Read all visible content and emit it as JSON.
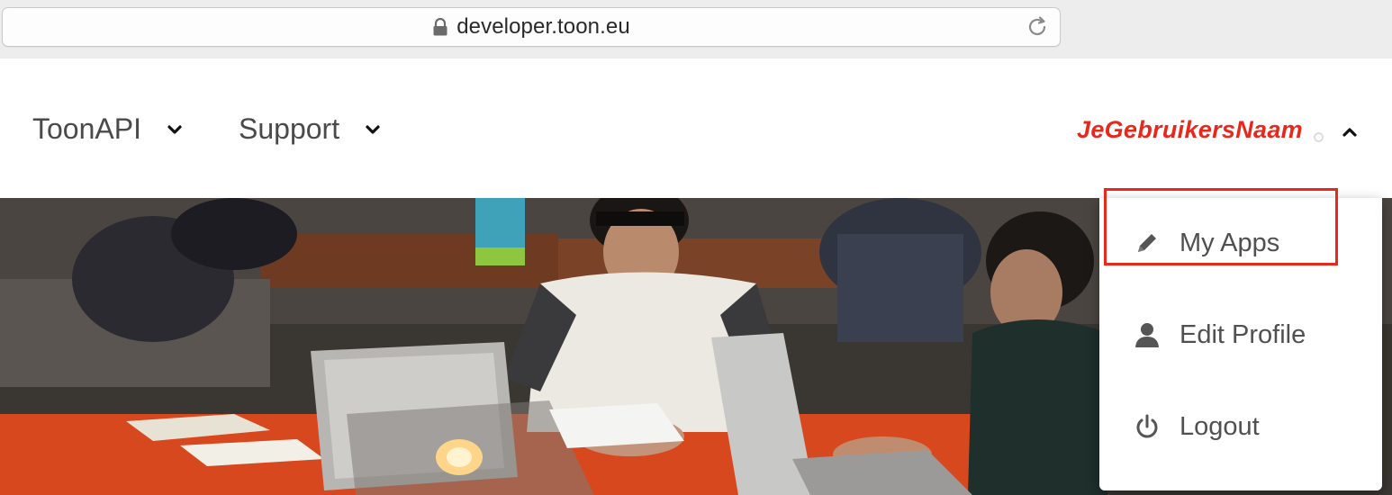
{
  "browser": {
    "url": "developer.toon.eu",
    "icons": [
      "lock-icon",
      "reload-icon"
    ]
  },
  "nav": {
    "items": [
      {
        "label": "ToonAPI",
        "icon": "chevron-down-icon"
      },
      {
        "label": "Support",
        "icon": "chevron-down-icon"
      }
    ],
    "user": {
      "name": "JeGebruikersNaam",
      "icon": "chevron-up-icon",
      "color": "#e8281c"
    }
  },
  "dropdown": {
    "items": [
      {
        "label": "My Apps",
        "icon": "pencil-icon"
      },
      {
        "label": "Edit Profile",
        "icon": "user-icon"
      },
      {
        "label": "Logout",
        "icon": "power-icon"
      }
    ],
    "highlight_color": "#e8281c"
  }
}
